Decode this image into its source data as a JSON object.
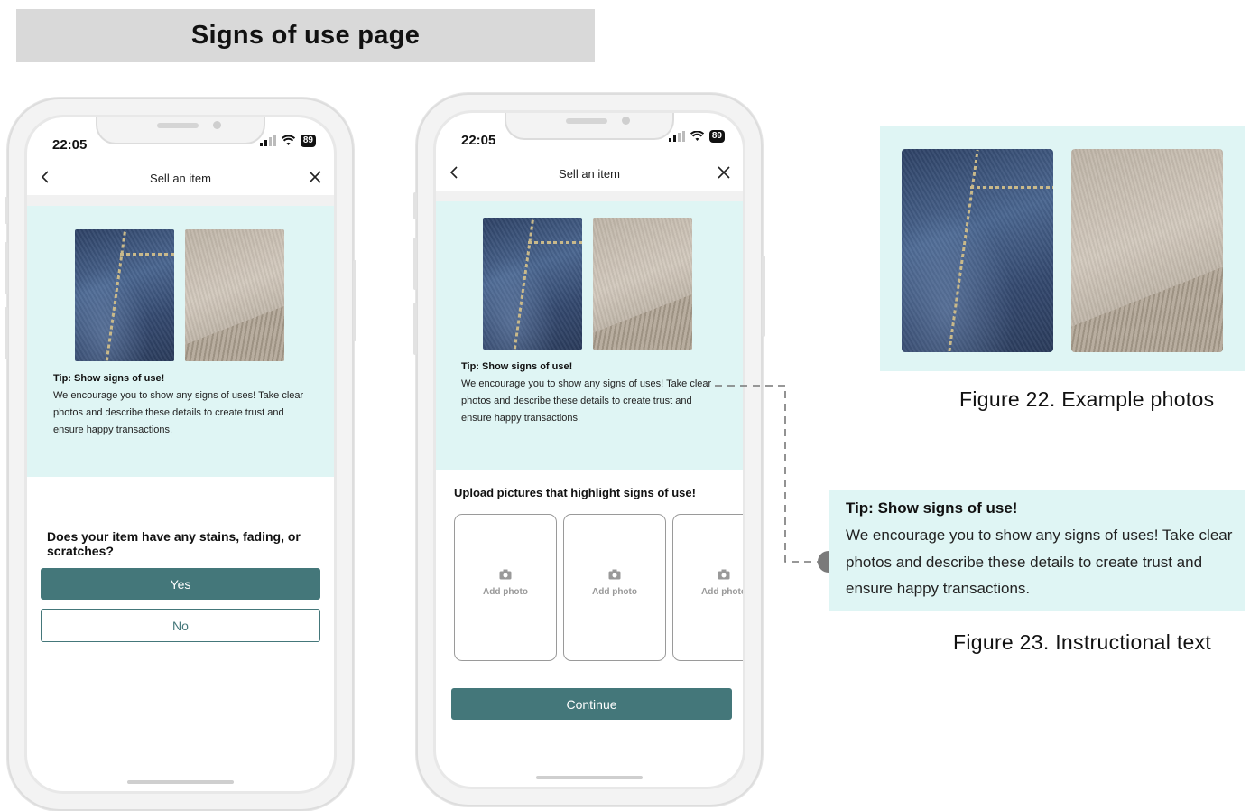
{
  "header": {
    "title": "Signs of use page"
  },
  "common": {
    "time": "22:05",
    "battery": "89",
    "nav_title": "Sell an item",
    "tip_title": "Tip: Show signs of use!",
    "tip_body": "We encourage you to show any signs of uses! Take clear photos and describe these details to create trust and ensure happy transactions."
  },
  "screen1": {
    "question": "Does your item have any stains, fading, or scratches?",
    "yes_label": "Yes",
    "no_label": "No"
  },
  "screen2": {
    "upload_label": "Upload pictures that highlight signs of use!",
    "slots": [
      {
        "label": "Add photo"
      },
      {
        "label": "Add photo"
      },
      {
        "label": "Add photo"
      }
    ],
    "continue_label": "Continue"
  },
  "figures": {
    "fig22_caption": "Figure 22.  Example photos",
    "fig23_caption": "Figure 23.  Instructional text"
  },
  "colors": {
    "accent": "#44777a",
    "tip_background": "#dff5f4",
    "banner": "#d9d9d9"
  }
}
